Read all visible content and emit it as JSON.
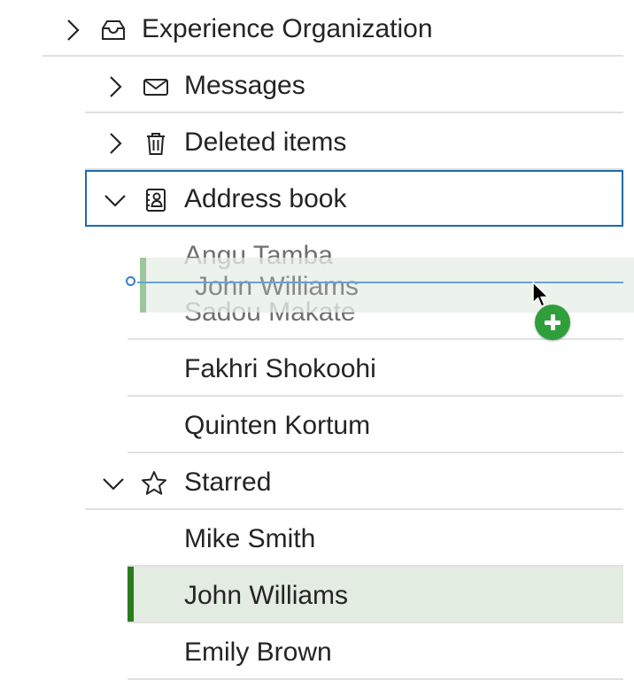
{
  "tree": {
    "root": {
      "label": "Experience Organization",
      "icon": "inbox-icon",
      "chevron": "chevron-right-icon"
    },
    "folders": [
      {
        "label": "Messages",
        "icon": "envelope-icon",
        "chevron": "chevron-right-icon"
      },
      {
        "label": "Deleted items",
        "icon": "trash-icon",
        "chevron": "chevron-right-icon"
      },
      {
        "label": "Address book",
        "icon": "contact-card-icon",
        "chevron": "chevron-down-icon"
      }
    ],
    "address_book": [
      "Angu Tamba",
      "Sadou Makate",
      "Fakhri Shokoohi",
      "Quinten Kortum"
    ],
    "starred": {
      "label": "Starred",
      "icon": "star-icon",
      "chevron": "chevron-down-icon",
      "items": [
        "Mike Smith",
        "John Williams",
        "Emily Brown"
      ]
    }
  },
  "drag": {
    "item_label": "John Williams",
    "indicator": "drop-position-indicator",
    "cursor_badge": "add-copy-icon"
  },
  "colors": {
    "focus_border": "#1e6aa9",
    "selected_background": "#e2ece0",
    "selected_accent": "#2b7a1e",
    "drop_line": "#69a1d6",
    "add_badge": "#2e9f3b"
  }
}
